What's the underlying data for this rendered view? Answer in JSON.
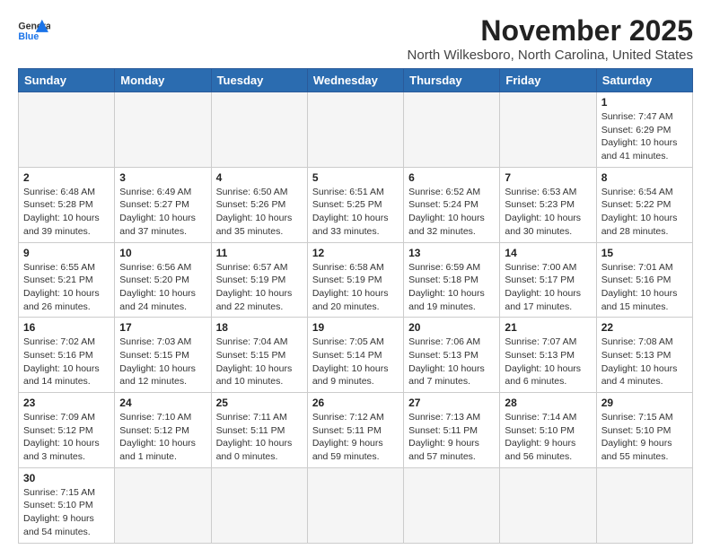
{
  "header": {
    "logo_text_general": "General",
    "logo_text_blue": "Blue",
    "month_title": "November 2025",
    "location": "North Wilkesboro, North Carolina, United States"
  },
  "days_of_week": [
    "Sunday",
    "Monday",
    "Tuesday",
    "Wednesday",
    "Thursday",
    "Friday",
    "Saturday"
  ],
  "weeks": [
    [
      {
        "day": "",
        "info": ""
      },
      {
        "day": "",
        "info": ""
      },
      {
        "day": "",
        "info": ""
      },
      {
        "day": "",
        "info": ""
      },
      {
        "day": "",
        "info": ""
      },
      {
        "day": "",
        "info": ""
      },
      {
        "day": "1",
        "info": "Sunrise: 7:47 AM\nSunset: 6:29 PM\nDaylight: 10 hours and 41 minutes."
      }
    ],
    [
      {
        "day": "2",
        "info": "Sunrise: 6:48 AM\nSunset: 5:28 PM\nDaylight: 10 hours and 39 minutes."
      },
      {
        "day": "3",
        "info": "Sunrise: 6:49 AM\nSunset: 5:27 PM\nDaylight: 10 hours and 37 minutes."
      },
      {
        "day": "4",
        "info": "Sunrise: 6:50 AM\nSunset: 5:26 PM\nDaylight: 10 hours and 35 minutes."
      },
      {
        "day": "5",
        "info": "Sunrise: 6:51 AM\nSunset: 5:25 PM\nDaylight: 10 hours and 33 minutes."
      },
      {
        "day": "6",
        "info": "Sunrise: 6:52 AM\nSunset: 5:24 PM\nDaylight: 10 hours and 32 minutes."
      },
      {
        "day": "7",
        "info": "Sunrise: 6:53 AM\nSunset: 5:23 PM\nDaylight: 10 hours and 30 minutes."
      },
      {
        "day": "8",
        "info": "Sunrise: 6:54 AM\nSunset: 5:22 PM\nDaylight: 10 hours and 28 minutes."
      }
    ],
    [
      {
        "day": "9",
        "info": "Sunrise: 6:55 AM\nSunset: 5:21 PM\nDaylight: 10 hours and 26 minutes."
      },
      {
        "day": "10",
        "info": "Sunrise: 6:56 AM\nSunset: 5:20 PM\nDaylight: 10 hours and 24 minutes."
      },
      {
        "day": "11",
        "info": "Sunrise: 6:57 AM\nSunset: 5:19 PM\nDaylight: 10 hours and 22 minutes."
      },
      {
        "day": "12",
        "info": "Sunrise: 6:58 AM\nSunset: 5:19 PM\nDaylight: 10 hours and 20 minutes."
      },
      {
        "day": "13",
        "info": "Sunrise: 6:59 AM\nSunset: 5:18 PM\nDaylight: 10 hours and 19 minutes."
      },
      {
        "day": "14",
        "info": "Sunrise: 7:00 AM\nSunset: 5:17 PM\nDaylight: 10 hours and 17 minutes."
      },
      {
        "day": "15",
        "info": "Sunrise: 7:01 AM\nSunset: 5:16 PM\nDaylight: 10 hours and 15 minutes."
      }
    ],
    [
      {
        "day": "16",
        "info": "Sunrise: 7:02 AM\nSunset: 5:16 PM\nDaylight: 10 hours and 14 minutes."
      },
      {
        "day": "17",
        "info": "Sunrise: 7:03 AM\nSunset: 5:15 PM\nDaylight: 10 hours and 12 minutes."
      },
      {
        "day": "18",
        "info": "Sunrise: 7:04 AM\nSunset: 5:15 PM\nDaylight: 10 hours and 10 minutes."
      },
      {
        "day": "19",
        "info": "Sunrise: 7:05 AM\nSunset: 5:14 PM\nDaylight: 10 hours and 9 minutes."
      },
      {
        "day": "20",
        "info": "Sunrise: 7:06 AM\nSunset: 5:13 PM\nDaylight: 10 hours and 7 minutes."
      },
      {
        "day": "21",
        "info": "Sunrise: 7:07 AM\nSunset: 5:13 PM\nDaylight: 10 hours and 6 minutes."
      },
      {
        "day": "22",
        "info": "Sunrise: 7:08 AM\nSunset: 5:13 PM\nDaylight: 10 hours and 4 minutes."
      }
    ],
    [
      {
        "day": "23",
        "info": "Sunrise: 7:09 AM\nSunset: 5:12 PM\nDaylight: 10 hours and 3 minutes."
      },
      {
        "day": "24",
        "info": "Sunrise: 7:10 AM\nSunset: 5:12 PM\nDaylight: 10 hours and 1 minute."
      },
      {
        "day": "25",
        "info": "Sunrise: 7:11 AM\nSunset: 5:11 PM\nDaylight: 10 hours and 0 minutes."
      },
      {
        "day": "26",
        "info": "Sunrise: 7:12 AM\nSunset: 5:11 PM\nDaylight: 9 hours and 59 minutes."
      },
      {
        "day": "27",
        "info": "Sunrise: 7:13 AM\nSunset: 5:11 PM\nDaylight: 9 hours and 57 minutes."
      },
      {
        "day": "28",
        "info": "Sunrise: 7:14 AM\nSunset: 5:10 PM\nDaylight: 9 hours and 56 minutes."
      },
      {
        "day": "29",
        "info": "Sunrise: 7:15 AM\nSunset: 5:10 PM\nDaylight: 9 hours and 55 minutes."
      }
    ],
    [
      {
        "day": "30",
        "info": "Sunrise: 7:15 AM\nSunset: 5:10 PM\nDaylight: 9 hours and 54 minutes."
      },
      {
        "day": "",
        "info": ""
      },
      {
        "day": "",
        "info": ""
      },
      {
        "day": "",
        "info": ""
      },
      {
        "day": "",
        "info": ""
      },
      {
        "day": "",
        "info": ""
      },
      {
        "day": "",
        "info": ""
      }
    ]
  ]
}
